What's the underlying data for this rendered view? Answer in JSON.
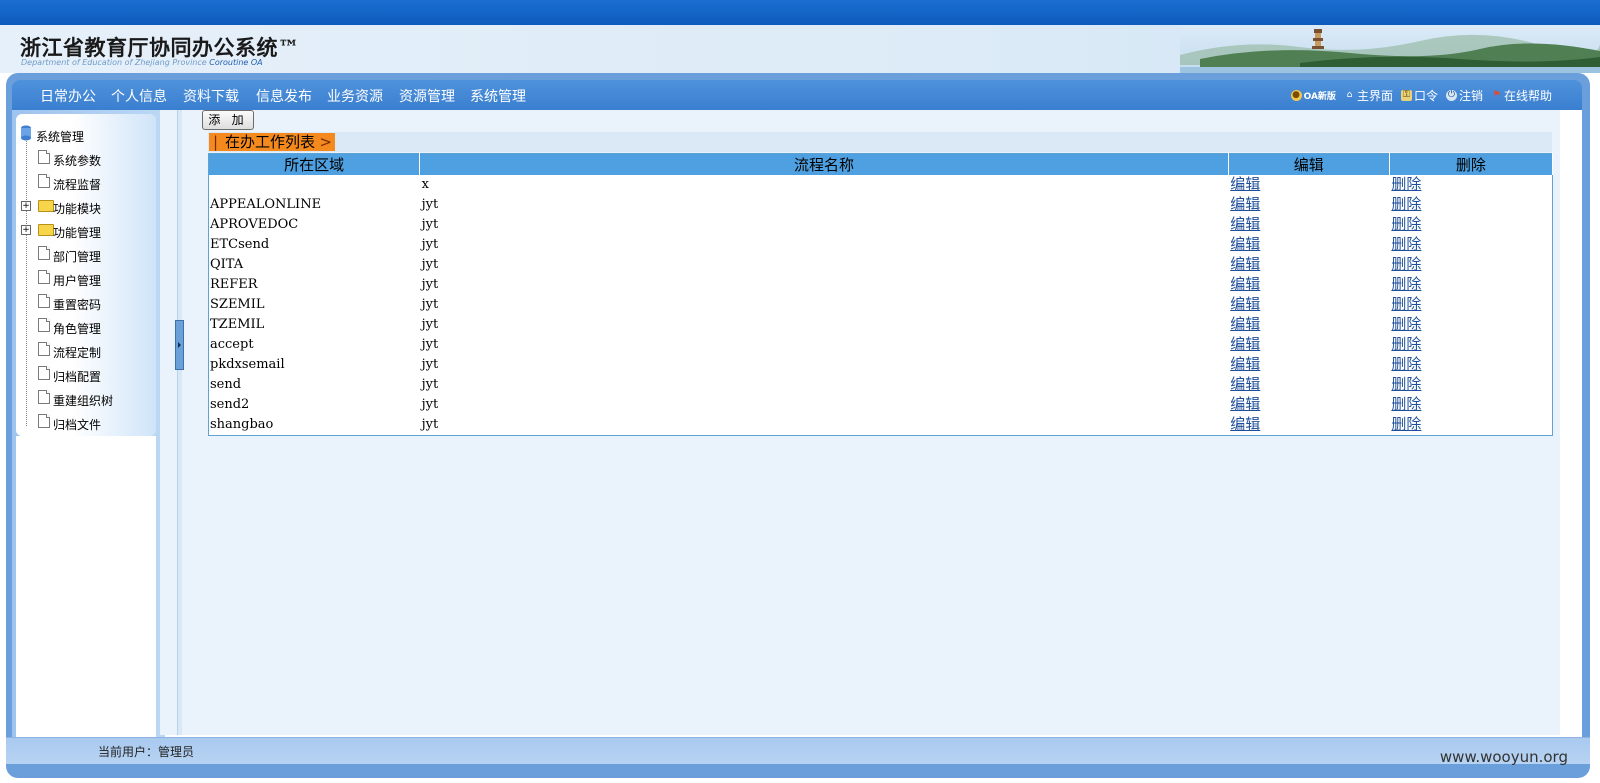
{
  "header": {
    "title": "浙江省教育厅协同办公系统™",
    "subtitle_prefix": "Department of Education of Zhejiang Province",
    "subtitle_brand": "Coroutine OA"
  },
  "nav": {
    "items": [
      "日常办公",
      "个人信息",
      "资料下载",
      "信息发布",
      "业务资源",
      "资源管理",
      "系统管理"
    ],
    "tools": {
      "oa_new": "OA新版",
      "home": "主界面",
      "password": "口令",
      "logout": "注销",
      "help": "在线帮助"
    }
  },
  "sidebar": {
    "root": "系统管理",
    "items": [
      {
        "label": "系统参数",
        "type": "doc"
      },
      {
        "label": "流程监督",
        "type": "doc"
      },
      {
        "label": "功能模块",
        "type": "folder"
      },
      {
        "label": "功能管理",
        "type": "folder"
      },
      {
        "label": "部门管理",
        "type": "doc"
      },
      {
        "label": "用户管理",
        "type": "doc"
      },
      {
        "label": "重置密码",
        "type": "doc"
      },
      {
        "label": "角色管理",
        "type": "doc"
      },
      {
        "label": "流程定制",
        "type": "doc"
      },
      {
        "label": "归档配置",
        "type": "doc"
      },
      {
        "label": "重建组织树",
        "type": "doc"
      },
      {
        "label": "归档文件",
        "type": "doc"
      }
    ]
  },
  "toolbar": {
    "add_label": "添 加"
  },
  "section": {
    "title": "在办工作列表",
    "pipe": "|",
    "chevron": ">"
  },
  "table": {
    "headers": [
      "所在区域",
      "流程名称",
      "编辑",
      "删除"
    ],
    "edit_label": "编辑",
    "delete_label": "删除",
    "rows": [
      {
        "area": "",
        "name": "x"
      },
      {
        "area": "APPEALONLINE",
        "name": "jyt"
      },
      {
        "area": "APROVEDOC",
        "name": "jyt"
      },
      {
        "area": "ETCsend",
        "name": "jyt"
      },
      {
        "area": "QITA",
        "name": "jyt"
      },
      {
        "area": "REFER",
        "name": "jyt"
      },
      {
        "area": "SZEMIL",
        "name": "jyt"
      },
      {
        "area": "TZEMIL",
        "name": "jyt"
      },
      {
        "area": "accept",
        "name": "jyt"
      },
      {
        "area": "pkdxsemail",
        "name": "jyt"
      },
      {
        "area": "send",
        "name": "jyt"
      },
      {
        "area": "send2",
        "name": "jyt"
      },
      {
        "area": "shangbao",
        "name": "jyt"
      }
    ]
  },
  "footer": {
    "current_user": "当前用户：管理员"
  },
  "watermark": "www.wooyun.org",
  "colors": {
    "nav_blue": "#3a7fd0",
    "header_blue": "#4fa0e0",
    "section_orange": "#f48a1e",
    "link": "#1f4f9a"
  }
}
